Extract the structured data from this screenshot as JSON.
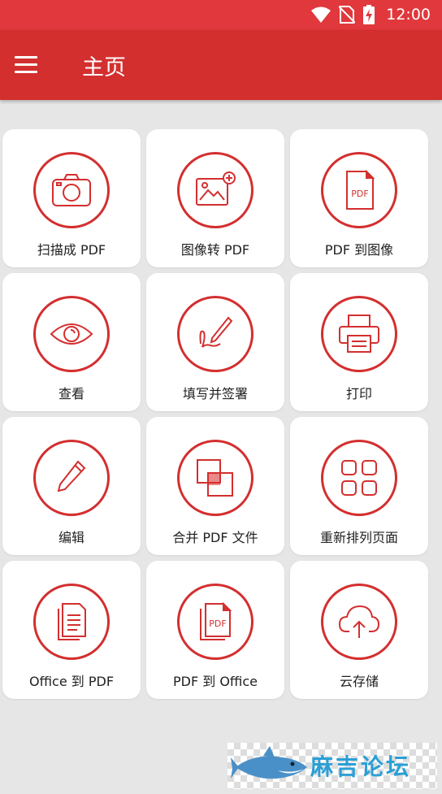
{
  "status": {
    "time": "12:00",
    "icons": [
      "wifi-icon",
      "no-sim-icon",
      "battery-charging-icon"
    ]
  },
  "appbar": {
    "title": "主页",
    "menu_icon": "hamburger-menu-icon"
  },
  "colors": {
    "primary": "#d32f2f",
    "status_bar": "#e0383c",
    "background": "#e6e6e6",
    "tile": "#ffffff"
  },
  "tiles": [
    {
      "label": "扫描成 PDF",
      "icon": "camera-icon"
    },
    {
      "label": "图像转 PDF",
      "icon": "add-image-icon"
    },
    {
      "label": "PDF 到图像",
      "icon": "pdf-file-icon"
    },
    {
      "label": "查看",
      "icon": "eye-icon"
    },
    {
      "label": "填写并签署",
      "icon": "signature-icon"
    },
    {
      "label": "打印",
      "icon": "printer-icon"
    },
    {
      "label": "编辑",
      "icon": "pencil-icon"
    },
    {
      "label": "合并 PDF 文件",
      "icon": "merge-icon"
    },
    {
      "label": "重新排列页面",
      "icon": "grid-pages-icon"
    },
    {
      "label": "Office 到 PDF",
      "icon": "document-icon"
    },
    {
      "label": "PDF 到 Office",
      "icon": "pdf-stack-icon"
    },
    {
      "label": "云存储",
      "icon": "cloud-upload-icon"
    }
  ],
  "watermark": {
    "text": "麻吉论坛",
    "icon": "shark-logo-icon"
  }
}
